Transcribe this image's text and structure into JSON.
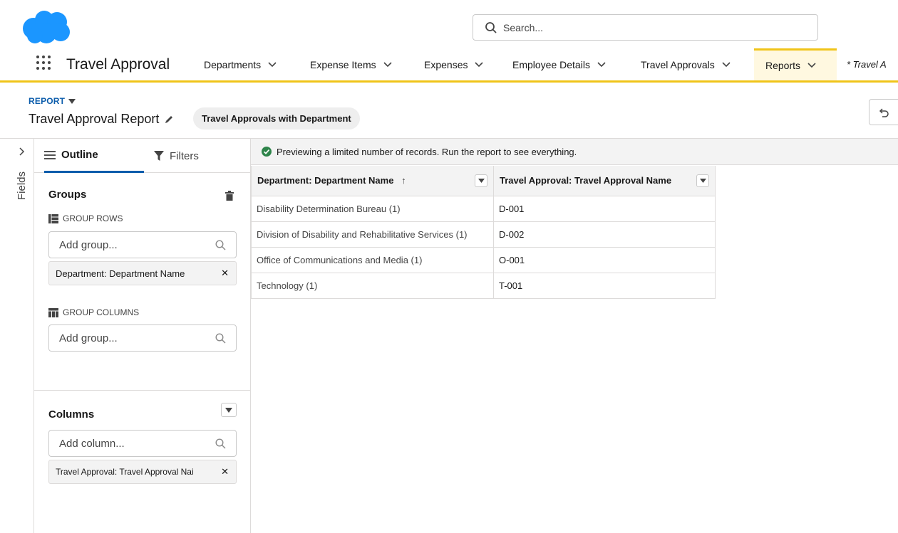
{
  "header": {
    "search_placeholder": "Search..."
  },
  "nav": {
    "app_name": "Travel Approval",
    "items": [
      {
        "label": "Departments"
      },
      {
        "label": "Expense Items"
      },
      {
        "label": "Expenses"
      },
      {
        "label": "Employee Details"
      },
      {
        "label": "Travel Approvals"
      },
      {
        "label": "Reports",
        "active": true
      },
      {
        "label": "* Travel A"
      }
    ]
  },
  "report": {
    "tag": "REPORT",
    "title": "Travel Approval Report",
    "type": "Travel Approvals with Department"
  },
  "sidebar": {
    "fields_label": "Fields"
  },
  "panel": {
    "tabs": {
      "outline": "Outline",
      "filters": "Filters"
    },
    "groups_title": "Groups",
    "group_rows_label": "GROUP ROWS",
    "add_group_placeholder": "Add group...",
    "group_row_value": "Department: Department Name",
    "group_columns_label": "GROUP COLUMNS",
    "add_group_col_placeholder": "Add group...",
    "columns_title": "Columns",
    "add_column_placeholder": "Add column...",
    "column_value": "Travel Approval: Travel Approval Nai"
  },
  "preview": {
    "notice": "Previewing a limited number of records. Run the report to see everything.",
    "columns": [
      "Department: Department Name",
      "Travel Approval: Travel Approval Name"
    ],
    "sort_indicator": "↑",
    "rows": [
      [
        "Disability Determination Bureau (1)",
        "D-001"
      ],
      [
        "Division of Disability and Rehabilitative Services (1)",
        "D-002"
      ],
      [
        "Office of Communications and Media (1)",
        "O-001"
      ],
      [
        "Technology (1)",
        "T-001"
      ]
    ]
  },
  "colors": {
    "brand_blue": "#0b5cab",
    "nav_accent": "#f0c419",
    "cloud_blue": "#1b96ff",
    "success_green": "#2e844a"
  }
}
